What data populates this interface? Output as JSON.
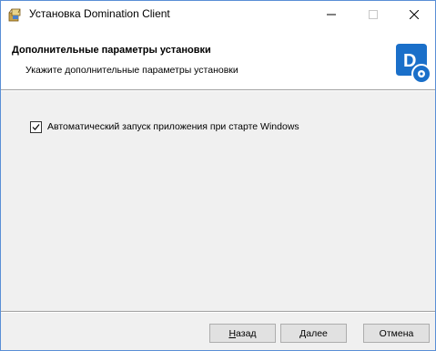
{
  "window": {
    "title": "Установка Domination Client",
    "app_icon": "installer-package-icon",
    "controls": {
      "minimize_icon": "minimize-icon",
      "maximize_icon": "maximize-icon",
      "close_icon": "close-icon"
    }
  },
  "header": {
    "title": "Дополнительные параметры установки",
    "subtitle": "Укажите дополнительные параметры установки",
    "logo_icon": "domination-client-logo-icon",
    "logo_color": "#1a6fc9"
  },
  "options": [
    {
      "label": "Автоматический запуск приложения при старте Windows",
      "checked": true
    }
  ],
  "buttons": {
    "back": {
      "mnemonic": "Н",
      "rest": "азад"
    },
    "next": {
      "mnemonic": "Д",
      "rest": "алее"
    },
    "cancel": {
      "label": "Отмена"
    }
  }
}
